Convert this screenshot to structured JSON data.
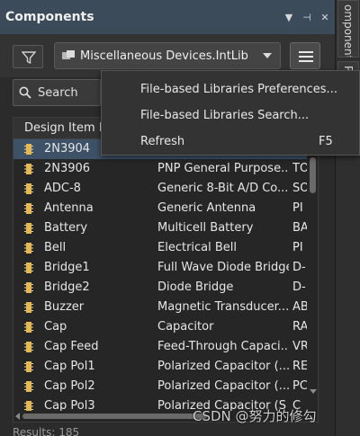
{
  "panel": {
    "title": "Components"
  },
  "dock": {
    "tab1": "omponents",
    "tab2": "P"
  },
  "toolbar": {
    "library": "Miscellaneous Devices.IntLib"
  },
  "search": {
    "placeholder": "Search"
  },
  "table": {
    "header": "Design Item I",
    "rows": [
      {
        "name": "2N3904",
        "desc": "",
        "lib": ""
      },
      {
        "name": "2N3906",
        "desc": "PNP General Purpose...",
        "lib": "TO"
      },
      {
        "name": "ADC-8",
        "desc": "Generic 8-Bit A/D Co...",
        "lib": "SO"
      },
      {
        "name": "Antenna",
        "desc": "Generic Antenna",
        "lib": "PI"
      },
      {
        "name": "Battery",
        "desc": "Multicell Battery",
        "lib": "BA"
      },
      {
        "name": "Bell",
        "desc": "Electrical Bell",
        "lib": "PI"
      },
      {
        "name": "Bridge1",
        "desc": "Full Wave Diode Bridge",
        "lib": "D-"
      },
      {
        "name": "Bridge2",
        "desc": "Diode Bridge",
        "lib": "D-"
      },
      {
        "name": "Buzzer",
        "desc": "Magnetic Transducer...",
        "lib": "AB"
      },
      {
        "name": "Cap",
        "desc": "Capacitor",
        "lib": "RA"
      },
      {
        "name": "Cap Feed",
        "desc": "Feed-Through Capaci...",
        "lib": "VR"
      },
      {
        "name": "Cap Pol1",
        "desc": "Polarized Capacitor (...",
        "lib": "RE"
      },
      {
        "name": "Cap Pol2",
        "desc": "Polarized Capacitor (...",
        "lib": "PC"
      },
      {
        "name": "Cap Pol3",
        "desc": "Polarized Capacitor (S",
        "lib": "C"
      }
    ]
  },
  "footer": {
    "results": "Results: 185"
  },
  "context_menu": {
    "items": [
      {
        "label": "File-based Libraries Preferences...",
        "shortcut": ""
      },
      {
        "label": "File-based Libraries Search...",
        "shortcut": ""
      },
      {
        "label": "Refresh",
        "shortcut": "F5"
      }
    ]
  },
  "watermark": "CSDN @努力的修勾",
  "colors": {
    "selected_row": "#3d5266",
    "titlebar": "#3c4b5a",
    "component_icon": "#e8b84a"
  }
}
